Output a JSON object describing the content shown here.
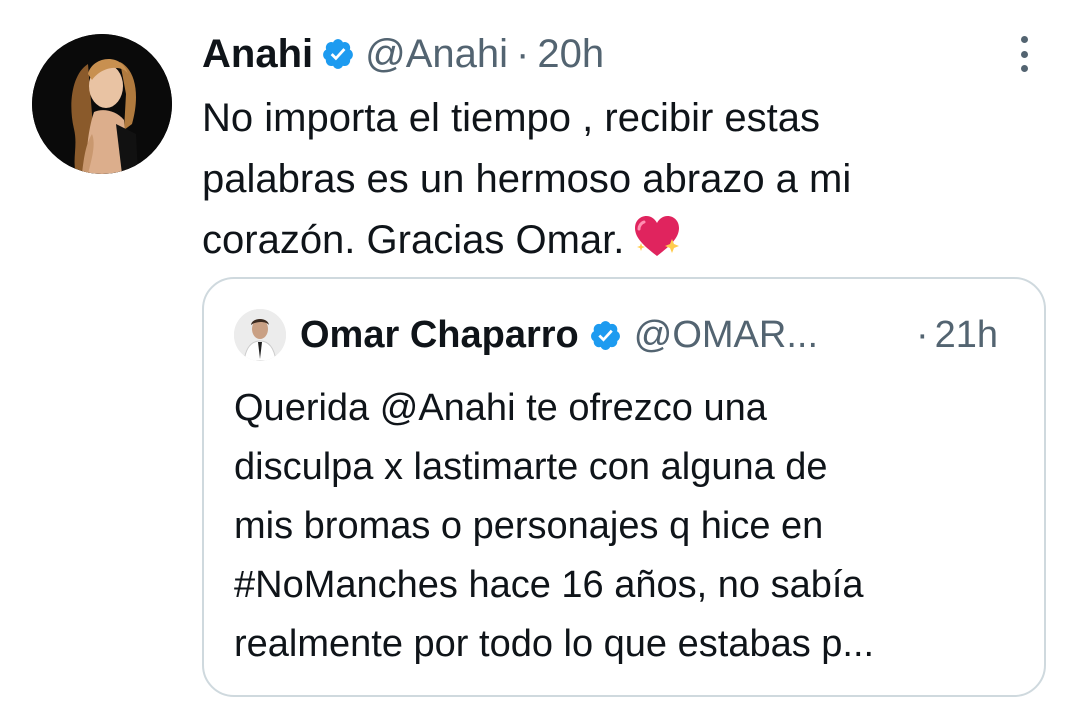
{
  "tweet": {
    "author_name": "Anahi",
    "author_handle": "@Anahi",
    "separator": "·",
    "time": "20h",
    "text_lines": [
      "No importa el tiempo , recibir estas",
      "palabras es un hermoso abrazo a mi",
      "corazón. Gracias Omar."
    ],
    "emoji_icon": "sparkling-heart-icon",
    "verified_icon": "verified-badge-icon",
    "more_icon": "more-options-icon"
  },
  "quoted_tweet": {
    "author_name": "Omar Chaparro",
    "author_handle": "@OMAR...",
    "separator": "·",
    "time": "21h",
    "text_lines": [
      "Querida @Anahi te ofrezco una",
      "disculpa x lastimarte con alguna de",
      "mis bromas o personajes q hice en",
      "#NoManches hace 16 años, no sabía",
      "realmente por todo lo que estabas p..."
    ]
  },
  "colors": {
    "verified": "#1d9bf0",
    "secondary_text": "#536471",
    "primary_text": "#0f1419",
    "border": "#cfd9de",
    "heart": "#e0245e"
  }
}
